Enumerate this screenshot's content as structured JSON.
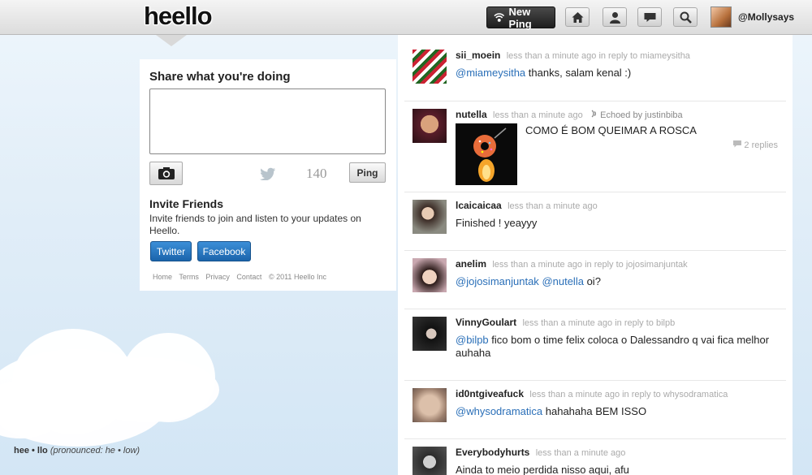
{
  "topbar": {
    "logo": "heello",
    "new_ping_label": "New Ping",
    "username": "@Mollysays"
  },
  "compose": {
    "title": "Share what you're doing",
    "char_count": "140",
    "ping_label": "Ping",
    "invite_title": "Invite Friends",
    "invite_text": "Invite friends to join and listen to your updates on Heello.",
    "twitter_label": "Twitter",
    "facebook_label": "Facebook",
    "footer": [
      "Home",
      "Terms",
      "Privacy",
      "Contact",
      "© 2011 Heello Inc"
    ]
  },
  "pronunciation": {
    "word": "hee • llo",
    "note": "(pronounced: he • low)"
  },
  "feed": [
    {
      "user": "sii_moein",
      "time": "less than a minute ago in reply to miameysitha",
      "mentions": [
        "@miameysitha"
      ],
      "text": "thanks, salam kenal :)"
    },
    {
      "user": "nutella",
      "time": "less than a minute ago",
      "echo": "Echoed by justinbiba",
      "text": "COMO É BOM QUEIMAR A ROSCA",
      "replies": "2 replies"
    },
    {
      "user": "lcaicaicaa",
      "time": "less than a minute ago",
      "text": "Finished ! yeayyy"
    },
    {
      "user": "anelim",
      "time": "less than a minute ago in reply to jojosimanjuntak",
      "mentions": [
        "@jojosimanjuntak",
        "@nutella"
      ],
      "text": "oi?"
    },
    {
      "user": "VinnyGoulart",
      "time": "less than a minute ago in reply to bilpb",
      "mentions": [
        "@bilpb"
      ],
      "text": "fico bom o time felix coloca o Dalessandro q vai fica melhor auhaha"
    },
    {
      "user": "id0ntgiveafuck",
      "time": "less than a minute ago in reply to whysodramatica",
      "mentions": [
        "@whysodramatica"
      ],
      "text": "hahahaha BEM ISSO"
    },
    {
      "user": "Everybodyhurts",
      "time": "less than a minute ago",
      "text": "Ainda to meio perdida nisso aqui, afu"
    }
  ]
}
